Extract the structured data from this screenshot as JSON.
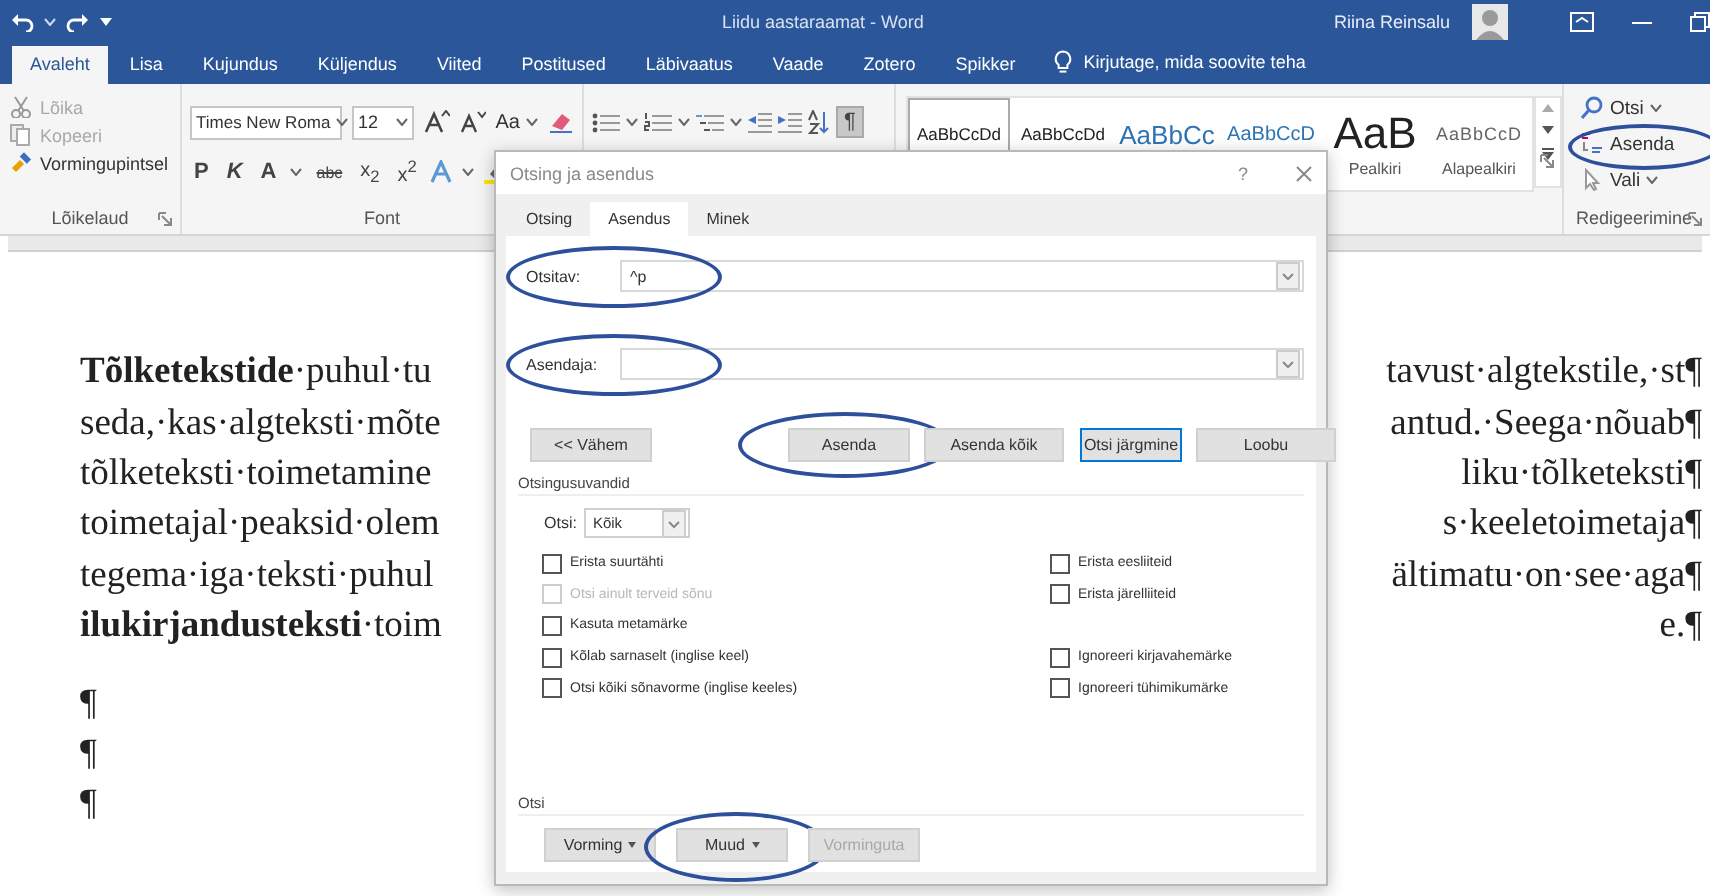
{
  "title_bar": {
    "title": "Liidu aastaraamat - Word",
    "user": "Riina Reinsalu"
  },
  "ribbon_tabs": [
    {
      "label": "Avaleht",
      "selected": true
    },
    {
      "label": "Lisa",
      "selected": false
    },
    {
      "label": "Kujundus",
      "selected": false
    },
    {
      "label": "Küljendus",
      "selected": false
    },
    {
      "label": "Viited",
      "selected": false
    },
    {
      "label": "Postitused",
      "selected": false
    },
    {
      "label": "Läbivaatus",
      "selected": false
    },
    {
      "label": "Vaade",
      "selected": false
    },
    {
      "label": "Zotero",
      "selected": false
    },
    {
      "label": "Spikker",
      "selected": false
    }
  ],
  "tell_me": "Kirjutage, mida soovite teha",
  "clipboard": {
    "label": "Lõikelaud",
    "items": [
      {
        "kind": "cut",
        "label": "Lõika",
        "disabled": true
      },
      {
        "kind": "copy",
        "label": "Kopeeri",
        "disabled": true
      },
      {
        "kind": "painter",
        "label": "Vormingupintsel",
        "disabled": false
      }
    ]
  },
  "font": {
    "label": "Font",
    "name": "Times New Roma",
    "size": "12",
    "case": "Aa",
    "bold": "P",
    "italic": "K",
    "underline": "A",
    "strike": "abc",
    "subscript": "x$_{2}$",
    "superscript": "x$^{2}$"
  },
  "paragraph": {
    "marks": {
      "glyph": "¶",
      "on": true
    }
  },
  "styles": {
    "items": [
      {
        "kind": "normal",
        "sample": "AaBbCcDd",
        "selected": true
      },
      {
        "kind": "normal",
        "sample": "AaBbCcDd",
        "selected": false
      },
      {
        "kind": "heading1",
        "sample": "AaBbCc",
        "selected": false
      },
      {
        "kind": "heading2",
        "sample": "AaBbCcD",
        "selected": false
      },
      {
        "kind": "title",
        "sample": "AaB",
        "name": "Pealkiri",
        "selected": false
      },
      {
        "kind": "subtitle",
        "sample": "AaBbCcD",
        "name": "Alapealkiri",
        "selected": false
      }
    ]
  },
  "editing": {
    "label": "Redigeerimine",
    "items": [
      {
        "kind": "find",
        "label": "Otsi",
        "circled": false
      },
      {
        "kind": "replace",
        "label": "Asenda",
        "circled": true
      },
      {
        "kind": "select",
        "label": "Vali",
        "circled": false
      }
    ]
  },
  "document": {
    "paragraphs": [
      {
        "lines": [
          {
            "left": "**Tõlketekstide**·puhul·tu",
            "right": "tavust·algtekstile,·st¶"
          },
          {
            "left": "seda,·kas·algteksti·mõte",
            "right": "antud.·Seega·nõuab¶"
          },
          {
            "left": "tõlketeksti·toimetamine",
            "right": "liku·tõlketeksti¶"
          },
          {
            "left": "toimetajal·peaksid·olem",
            "right": "s·keeletoimetaja¶"
          },
          {
            "left": "tegema·iga·teksti·puhul",
            "right": "ältimatu·on·see·aga¶"
          },
          {
            "left": "**ilukirjandusteksti**·toim",
            "right": "e.¶"
          }
        ]
      },
      {
        "lines": [
          {
            "left": "¶"
          }
        ]
      },
      {
        "lines": [
          {
            "left": "¶"
          }
        ]
      },
      {
        "lines": [
          {
            "left": "¶"
          }
        ]
      }
    ]
  },
  "dialog": {
    "title": "Otsing ja asendus",
    "help": "?",
    "tabs": [
      {
        "label": "Otsing",
        "selected": false
      },
      {
        "label": "Asendus",
        "selected": true
      },
      {
        "label": "Minek",
        "selected": false
      }
    ],
    "fields": [
      {
        "label": "Otsitav:",
        "value": "^p",
        "circled": true
      },
      {
        "label": "Asendaja:",
        "circled": true
      }
    ],
    "buttons": [
      {
        "label": "<< Vähem",
        "default": false,
        "circled": false
      },
      {
        "label": "Asenda",
        "default": false,
        "circled": true
      },
      {
        "label": "Asenda kõik",
        "default": false,
        "circled": false
      },
      {
        "label": "Otsi järgmine",
        "default": true,
        "circled": false
      },
      {
        "label": "Loobu",
        "default": false,
        "circled": false
      }
    ],
    "options_title": "Otsingusuvandid",
    "search_label": "Otsi:",
    "search_value": "Kõik",
    "option_rows": [
      {
        "left": {
          "label": "Erista suurtähti",
          "checked": false,
          "disabled": false
        },
        "right": {
          "label": "Erista eesliiteid",
          "checked": false,
          "disabled": false
        }
      },
      {
        "left": {
          "label": "Otsi ainult terveid sõnu",
          "checked": false,
          "disabled": true
        },
        "right": {
          "label": "Erista järelliiteid",
          "checked": false,
          "disabled": false
        }
      },
      {
        "left": {
          "label": "Kasuta metamärke",
          "checked": false,
          "disabled": false
        }
      },
      {
        "left": {
          "label": "Kõlab sarnaselt (inglise keel)",
          "checked": false,
          "disabled": false
        },
        "right": {
          "label": "Ignoreeri kirjavahemärke",
          "checked": false,
          "disabled": false
        }
      },
      {
        "left": {
          "label": "Otsi kõiki sõnavorme (inglise keeles)",
          "checked": false,
          "disabled": false
        },
        "right": {
          "label": "Ignoreeri tühimikumärke",
          "checked": false,
          "disabled": false
        }
      }
    ],
    "find_title": "Otsi",
    "bottom_buttons": [
      {
        "label": "Vorming",
        "menu": true,
        "disabled": false,
        "circled": false
      },
      {
        "label": "Muud",
        "menu": true,
        "disabled": false,
        "circled": true
      },
      {
        "label": "Vorminguta",
        "menu": false,
        "disabled": true,
        "circled": false
      }
    ]
  }
}
